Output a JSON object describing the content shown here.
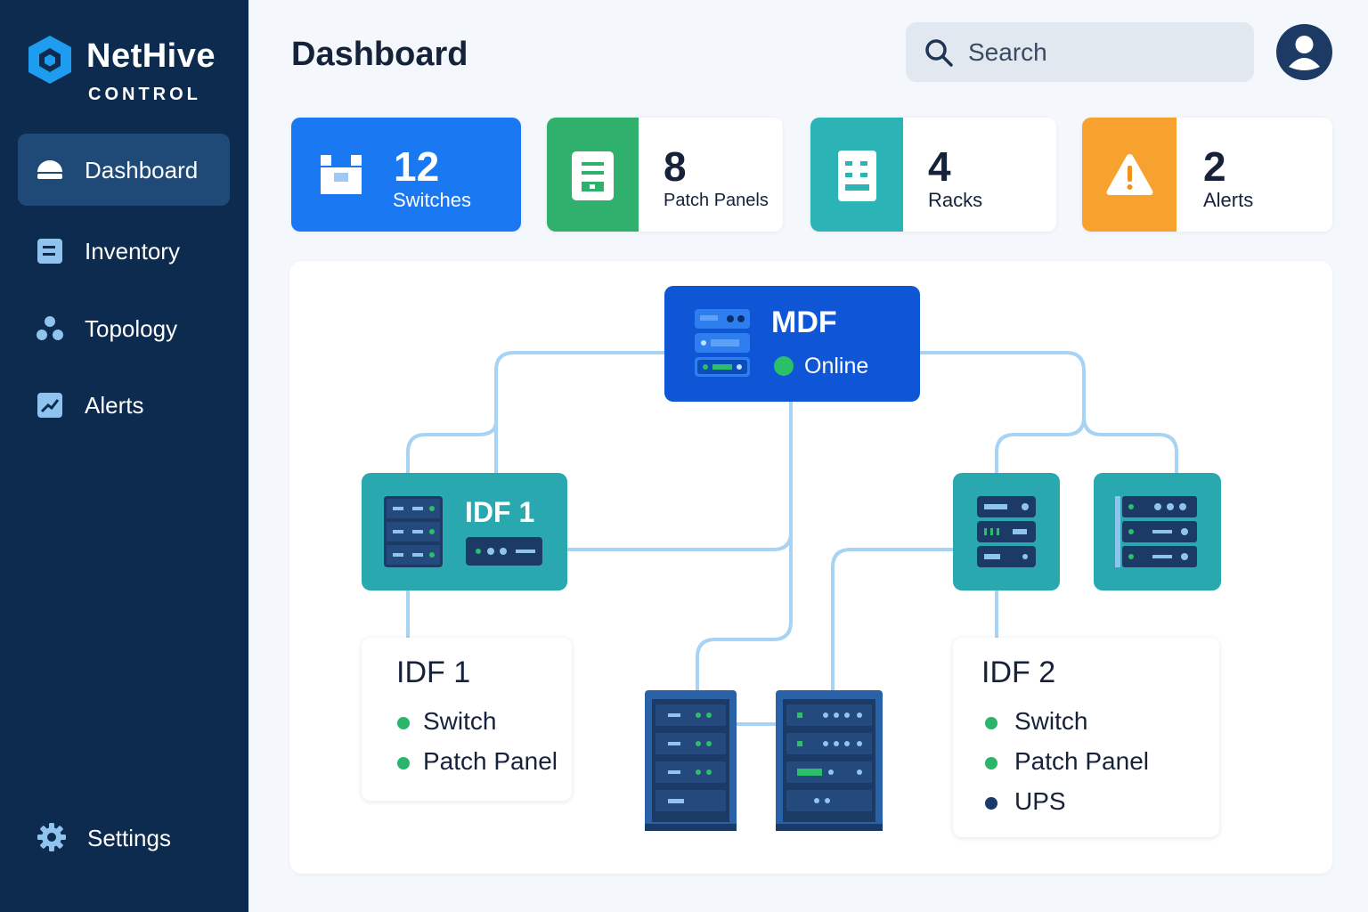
{
  "app": {
    "name": "NetHive",
    "subtitle": "CONTROL"
  },
  "sidebar": {
    "items": [
      {
        "label": "Dashboard",
        "icon": "dashboard-icon",
        "active": true
      },
      {
        "label": "Inventory",
        "icon": "inventory-icon",
        "active": false
      },
      {
        "label": "Topology",
        "icon": "topology-icon",
        "active": false
      },
      {
        "label": "Alerts",
        "icon": "alerts-icon",
        "active": false
      }
    ],
    "settings": {
      "label": "Settings",
      "icon": "gear-icon"
    }
  },
  "header": {
    "title": "Dashboard",
    "search_placeholder": "Search"
  },
  "stats": [
    {
      "value": "12",
      "label": "Switches",
      "icon": "switch-icon",
      "color": "#1a78f2"
    },
    {
      "value": "8",
      "label": "Patch Panels",
      "icon": "patch-panel-icon",
      "color": "#2fb06c"
    },
    {
      "value": "4",
      "label": "Racks",
      "icon": "rack-icon",
      "color": "#2bb3b5"
    },
    {
      "value": "2",
      "label": "Alerts",
      "icon": "warning-icon",
      "color": "#f7a22e"
    }
  ],
  "topology": {
    "mdf": {
      "title": "MDF",
      "status": "Online",
      "status_color": "#2bbf6a"
    },
    "idf1_node": {
      "title": "IDF 1"
    },
    "idf1_card": {
      "title": "IDF 1",
      "items": [
        {
          "label": "Switch",
          "status_color": "#2bb56a"
        },
        {
          "label": "Patch Panel",
          "status_color": "#2bb56a"
        }
      ]
    },
    "idf2_card": {
      "title": "IDF 2",
      "items": [
        {
          "label": "Switch",
          "status_color": "#2bb56a"
        },
        {
          "label": "Patch Panel",
          "status_color": "#2bb56a"
        },
        {
          "label": "UPS",
          "status_color": "#1a3a6b"
        }
      ]
    }
  },
  "colors": {
    "sidebar_bg": "#0d2a4f",
    "sidebar_active": "#1f4a78",
    "accent": "#1a78f2",
    "link_line": "#a7d3f5",
    "teal_node": "#2aa8b0",
    "mdf_node": "#0f56d6"
  }
}
